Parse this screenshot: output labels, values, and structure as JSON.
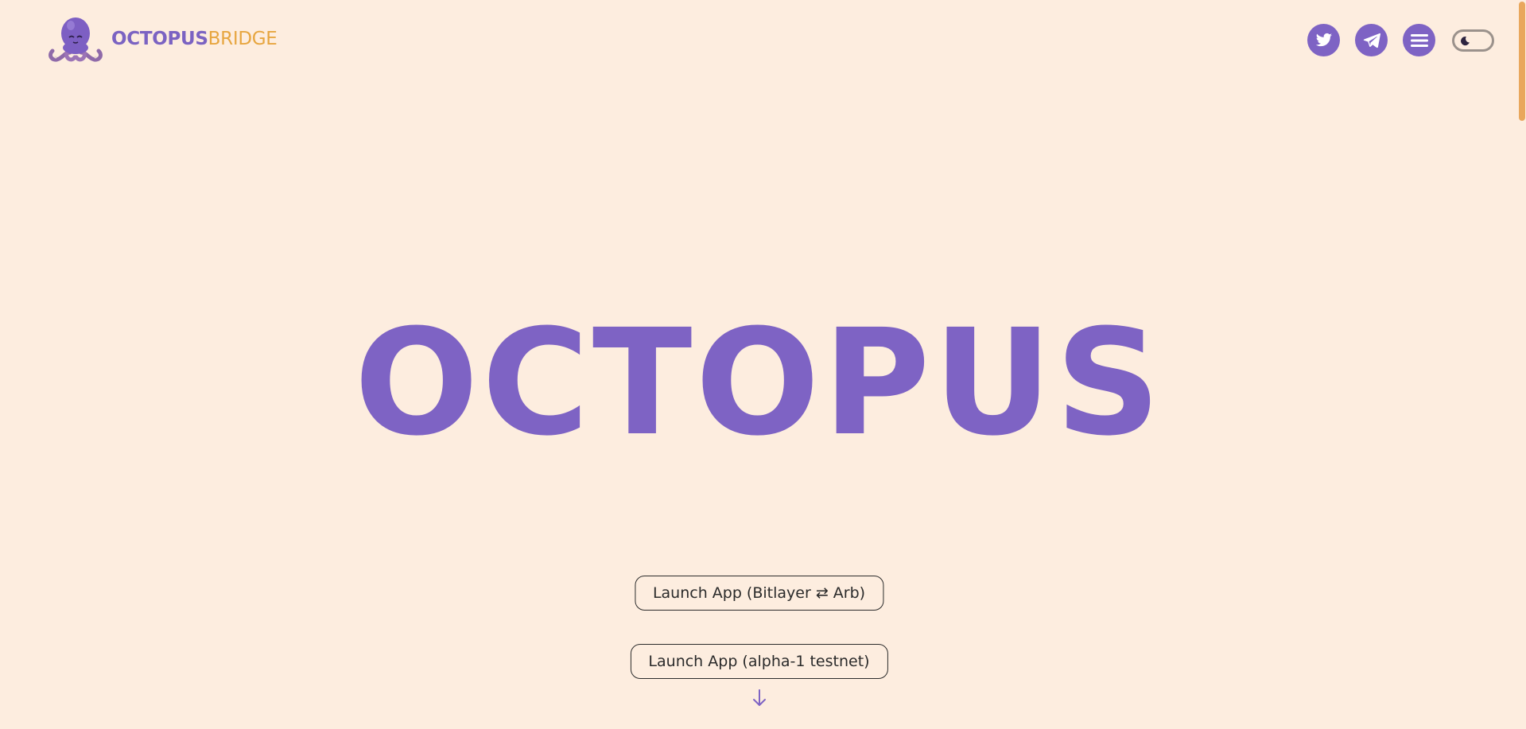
{
  "header": {
    "brand_part1": "OCTOPUS",
    "brand_part2": "BRIDGE",
    "logo_icon": "octopus-mascot-icon",
    "actions": [
      {
        "icon": "twitter-icon"
      },
      {
        "icon": "telegram-icon"
      },
      {
        "icon": "menu-icon"
      }
    ],
    "theme_toggle_icon": "moon-icon"
  },
  "hero": {
    "title": "OCTOPUS",
    "buttons": [
      {
        "label": "Launch App (Bitlayer ⇄ Arb)"
      },
      {
        "label": "Launch App (alpha-1 testnet)"
      }
    ],
    "scroll_icon": "arrow-down-icon"
  },
  "colors": {
    "background": "#fdeddf",
    "accent_purple": "#7e63c4",
    "accent_orange": "#e7a640",
    "scrollbar": "#e9a75c"
  }
}
